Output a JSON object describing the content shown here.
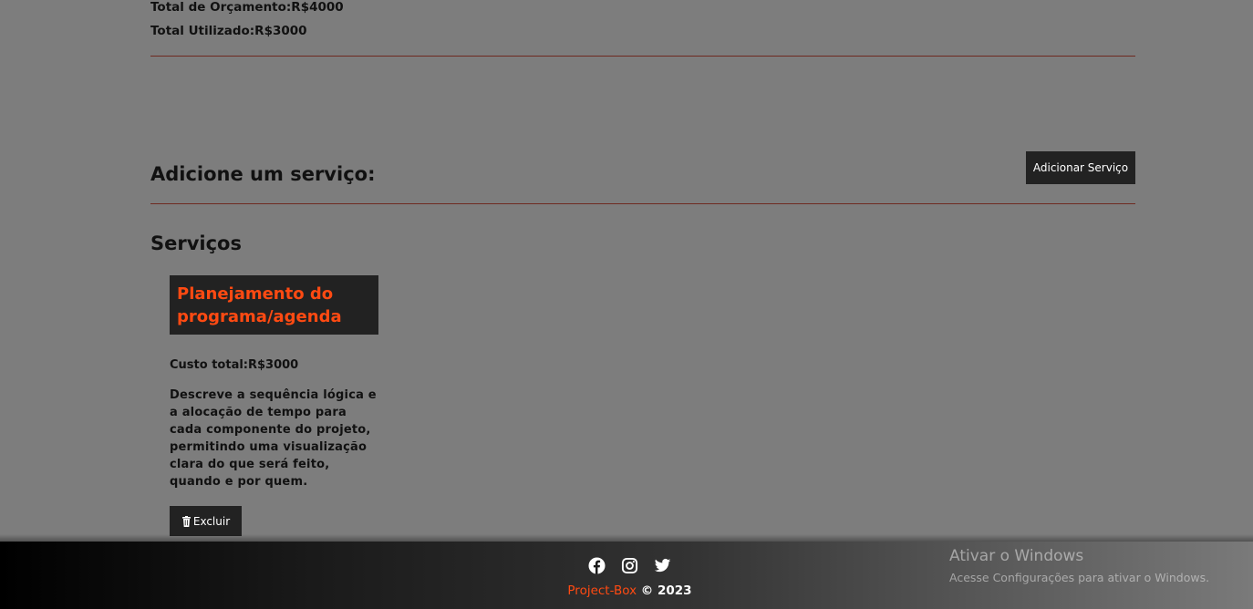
{
  "summary": {
    "total_budget": "Total de Orçamento:R$4000",
    "total_used": "Total Utilizado:R$3000"
  },
  "add_service": {
    "heading": "Adicione um serviço:",
    "button_label": "Adicionar Serviço"
  },
  "services": {
    "heading": "Serviços",
    "items": [
      {
        "title": "Planejamento do programa/agenda",
        "cost": "Custo total:R$3000",
        "description": "Descreve a sequência lógica e a alocação de tempo para cada componente do projeto, permitindo uma visualização clara do que será feito, quando e por quem.",
        "delete_label": "Excluir"
      }
    ]
  },
  "footer": {
    "social": [
      "facebook-icon",
      "instagram-icon",
      "twitter-icon"
    ],
    "brand": "Project-Box",
    "copyright": " © 2023",
    "accent_color": "#ff4a12"
  },
  "os_watermark": {
    "title": "Ativar o Windows",
    "subtitle": "Acesse Configurações para ativar o Windows."
  }
}
